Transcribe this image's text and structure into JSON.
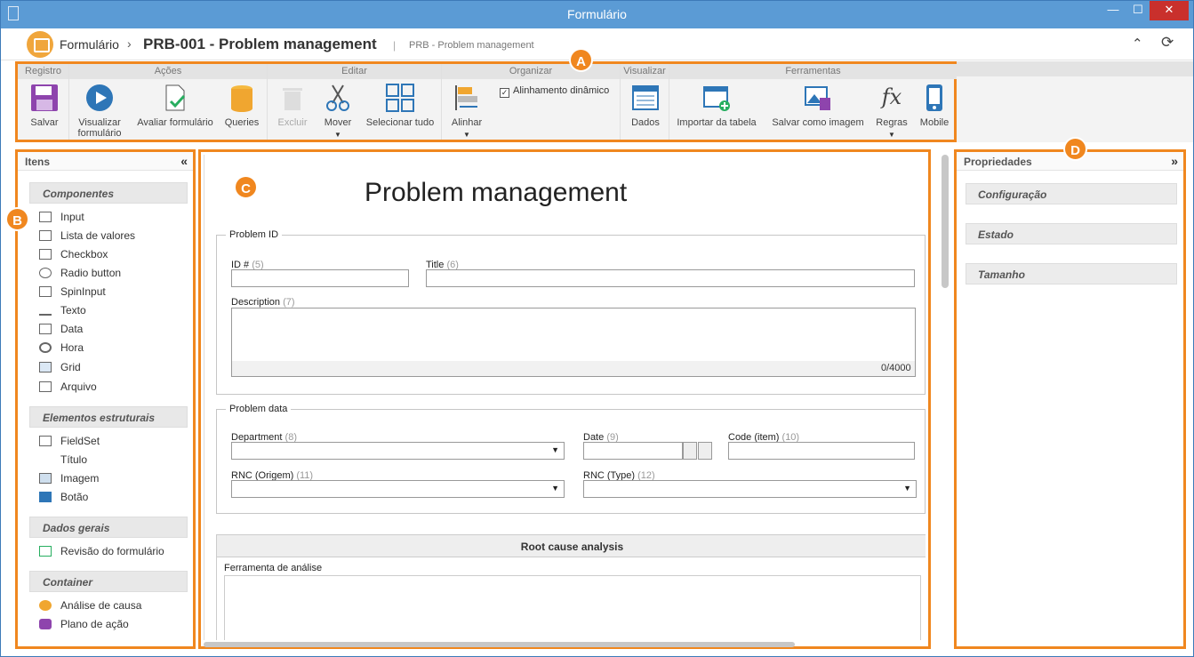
{
  "window": {
    "title": "Formulário",
    "min": "—",
    "max": "☐",
    "close": "✕"
  },
  "appbar": {
    "root": "Formulário",
    "sep": "›",
    "current": "PRB-001 - Problem management",
    "bar": "|",
    "sub": "PRB - Problem management",
    "up_icon": "⌃",
    "refresh_icon": "⟳"
  },
  "ribbon": {
    "groups": {
      "registro": "Registro",
      "acoes": "Ações",
      "editar": "Editar",
      "organizar": "Organizar",
      "visualizar": "Visualizar",
      "ferramentas": "Ferramentas"
    },
    "salvar": "Salvar",
    "visualizar_formulario": "Visualizar formulário",
    "avaliar": "Avaliar formulário",
    "queries": "Queries",
    "excluir": "Excluir",
    "mover": "Mover",
    "selecionar": "Selecionar tudo",
    "alinhar": "Alinhar",
    "alinhamento": "Alinhamento dinâmico",
    "dados": "Dados",
    "importar": "Importar da tabela",
    "salvar_imagem": "Salvar como imagem",
    "regras": "Regras",
    "mobile": "Mobile"
  },
  "badges": {
    "a": "A",
    "b": "B",
    "c": "C",
    "d": "D"
  },
  "items_panel": {
    "title": "Itens",
    "collapse": "«",
    "componentes": "Componentes",
    "components": [
      "Input",
      "Lista de valores",
      "Checkbox",
      "Radio button",
      "SpinInput",
      "Texto",
      "Data",
      "Hora",
      "Grid",
      "Arquivo"
    ],
    "estruturais": "Elementos estruturais",
    "structural": [
      "FieldSet",
      "Título",
      "Imagem",
      "Botão"
    ],
    "gerais": "Dados gerais",
    "general": [
      "Revisão do formulário"
    ],
    "container": "Container",
    "containers": [
      "Análise de causa",
      "Plano de ação"
    ]
  },
  "props_panel": {
    "title": "Propriedades",
    "expand": "»",
    "sections": [
      "Configuração",
      "Estado",
      "Tamanho"
    ]
  },
  "form": {
    "title": "Problem management",
    "fs1": "Problem ID",
    "id_label": "ID #",
    "id_num": "(5)",
    "title_label": "Title",
    "title_num": "(6)",
    "desc_label": "Description",
    "desc_num": "(7)",
    "counter": "0/4000",
    "fs2": "Problem data",
    "dept_label": "Department",
    "dept_num": "(8)",
    "date_label": "Date",
    "date_num": "(9)",
    "code_label": "Code (item)",
    "code_num": "(10)",
    "rnc_o_label": "RNC (Origem)",
    "rnc_o_num": "(11)",
    "rnc_t_label": "RNC (Type)",
    "rnc_t_num": "(12)",
    "rca": "Root cause analysis",
    "ferramenta": "Ferramenta de análise",
    "arrow": "▼"
  }
}
